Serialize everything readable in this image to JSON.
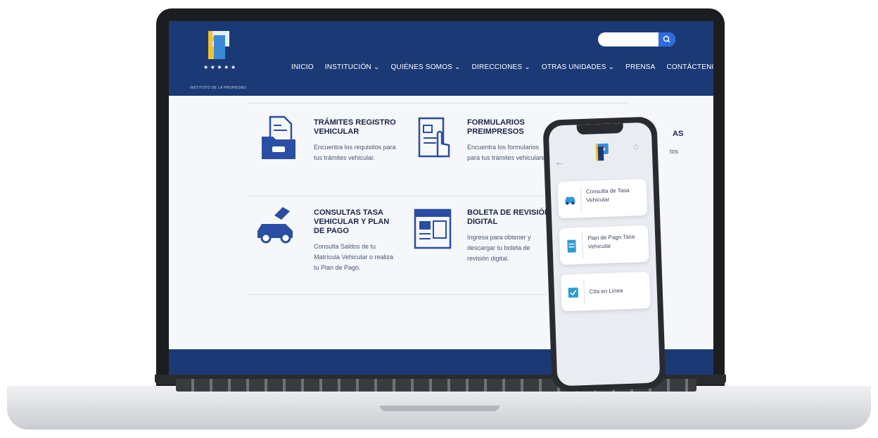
{
  "header": {
    "logo_text": "INSTITUTO DE LA PROPIEDAD",
    "nav": [
      {
        "label": "INICIO",
        "dropdown": false
      },
      {
        "label": "INSTITUCIÓN",
        "dropdown": true
      },
      {
        "label": "QUIÉNES SOMOS",
        "dropdown": true
      },
      {
        "label": "DIRECCIONES",
        "dropdown": true
      },
      {
        "label": "OTRAS UNIDADES",
        "dropdown": true
      },
      {
        "label": "PRENSA",
        "dropdown": false
      },
      {
        "label": "CONTÁCTENOS",
        "dropdown": true
      }
    ],
    "search_placeholder": ""
  },
  "cards": [
    {
      "title": "TRÁMITES REGISTRO VEHICULAR",
      "desc": "Encuentra los requisitos para tus trámites vehicular.",
      "icon": "folder-document-car-icon"
    },
    {
      "title": "FORMULARIOS PREIMPRESOS",
      "desc": "Encuentra los formularios para tus trámites vehiculares",
      "icon": "form-pointer-icon"
    },
    {
      "title": "CONSULTAS TASA VEHICULAR Y PLAN DE PAGO",
      "desc": "Consulta Saldos de tu Matrícula Vehicular o realiza tu Plan de Pago.",
      "icon": "car-money-icon"
    },
    {
      "title": "BOLETA DE REVISIÓN DIGITAL",
      "desc": "Ingresa para obtener y descargar tu boleta de revisión digital.",
      "icon": "revision-ticket-icon"
    }
  ],
  "partial_card": {
    "title_fragment": "AS",
    "desc_fragment": "tos"
  },
  "phone": {
    "items": [
      {
        "label": "Consulta de Tasa Vehicular",
        "icon": "car-icon"
      },
      {
        "label": "Plan de Pago Tasa Vehicular",
        "icon": "document-icon"
      },
      {
        "label": "Cita en Línea",
        "icon": "calendar-check-icon"
      }
    ]
  },
  "colors": {
    "brand_navy": "#1b3a75",
    "accent_blue": "#2f6be0",
    "icon_blue": "#2a4ea3"
  }
}
